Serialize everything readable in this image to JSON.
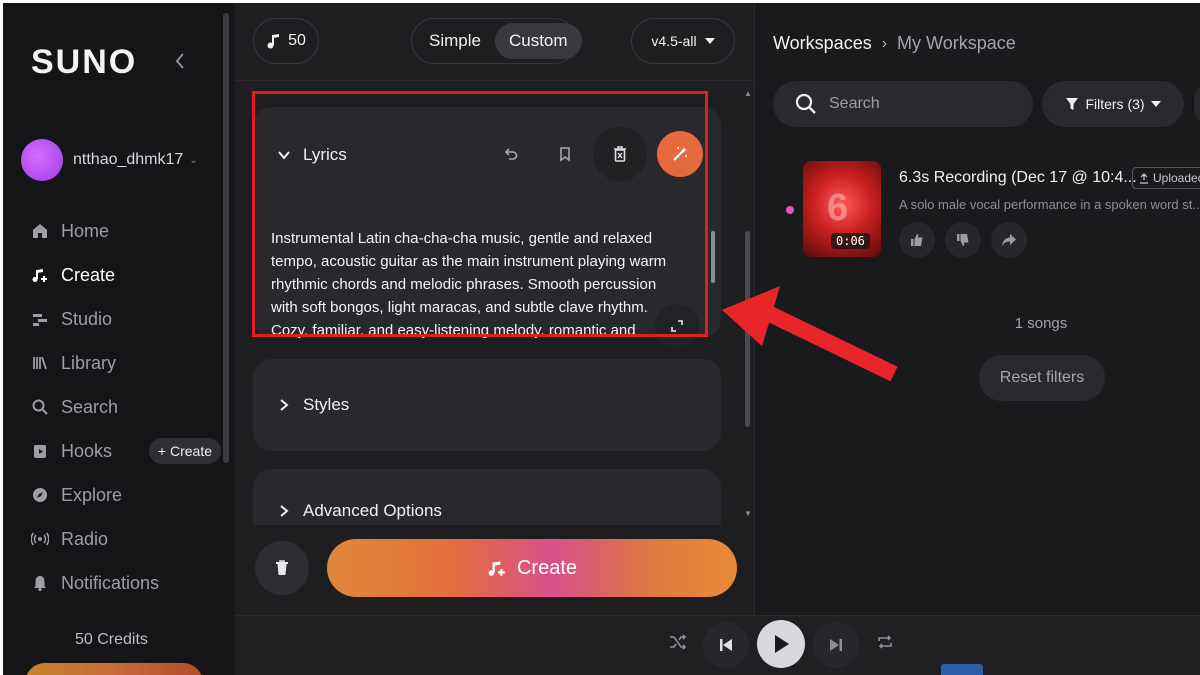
{
  "sidebar": {
    "logo": "SUNO",
    "username": "ntthao_dhmk17",
    "nav": [
      {
        "label": "Home",
        "icon": "home-icon"
      },
      {
        "label": "Create",
        "icon": "music-plus-icon",
        "active": true
      },
      {
        "label": "Studio",
        "icon": "studio-icon"
      },
      {
        "label": "Library",
        "icon": "library-icon"
      },
      {
        "label": "Search",
        "icon": "search-icon"
      },
      {
        "label": "Hooks",
        "icon": "hooks-icon"
      },
      {
        "label": "Explore",
        "icon": "compass-icon"
      },
      {
        "label": "Radio",
        "icon": "radio-icon"
      },
      {
        "label": "Notifications",
        "icon": "bell-icon"
      }
    ],
    "hooks_create": "+ Create",
    "credits": "50 Credits"
  },
  "topbar": {
    "credits": "50",
    "mode_simple": "Simple",
    "mode_custom": "Custom",
    "version": "v4.5-all"
  },
  "lyrics": {
    "label": "Lyrics",
    "text": "Instrumental Latin cha-cha-cha music, gentle and relaxed tempo, acoustic guitar as the main instrument playing warm rhythmic chords and melodic phrases. Smooth percussion with soft bongos, light maracas, and subtle clave rhythm. Cozy, familiar, and easy-listening melody, romantic and"
  },
  "styles": {
    "label": "Styles"
  },
  "advanced": {
    "label": "Advanced Options"
  },
  "create_button": "Create",
  "workspace": {
    "root": "Workspaces",
    "current": "My Workspace",
    "search_placeholder": "Search",
    "filters": "Filters (3)"
  },
  "song": {
    "title": "6.3s Recording (Dec 17 @ 10:4...",
    "badge": "Uploaded",
    "description": "A solo male vocal performance in a spoken word st...",
    "duration": "0:06",
    "cover_text": "6"
  },
  "results": {
    "count": "1 songs",
    "reset": "Reset filters"
  },
  "colors": {
    "accent": "#e56a3c",
    "highlight_box": "#e01e1e",
    "annotation_arrow": "#e8262a"
  }
}
